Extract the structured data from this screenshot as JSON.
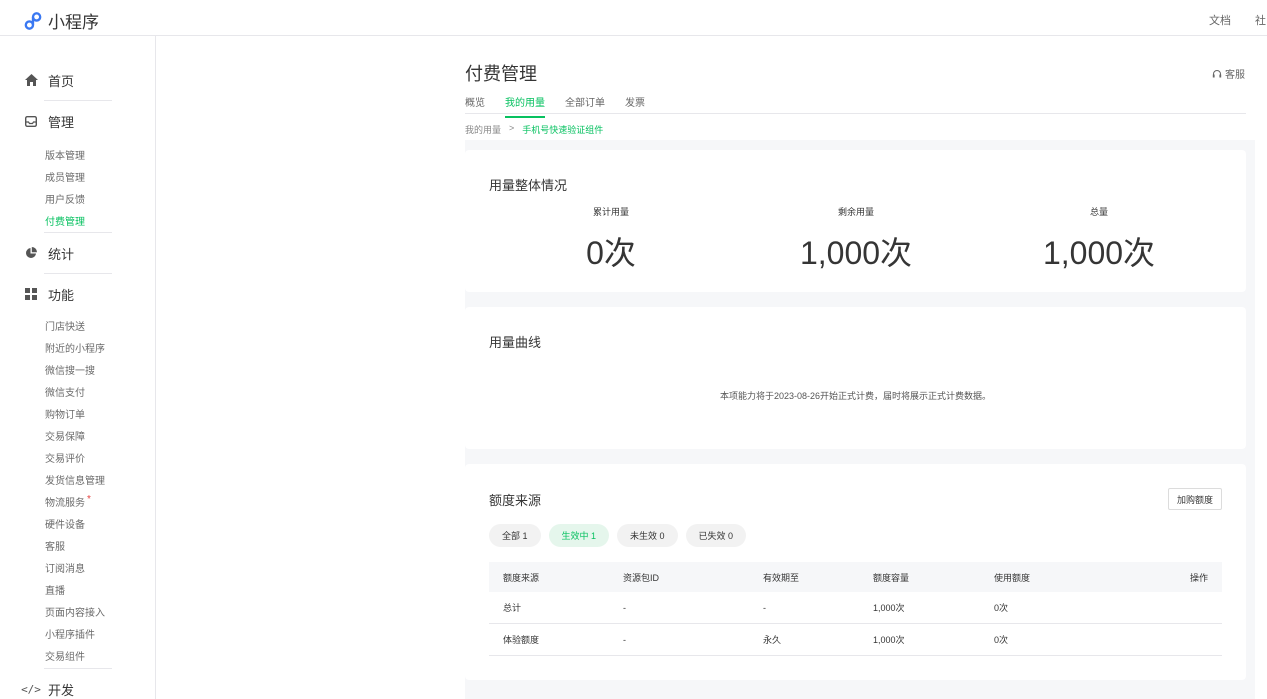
{
  "app": {
    "title": "小程序"
  },
  "top_links": [
    "文档",
    "社区"
  ],
  "sidebar": {
    "home": "首页",
    "manage": "管理",
    "manage_items": [
      "版本管理",
      "成员管理",
      "用户反馈",
      "付费管理"
    ],
    "stats": "统计",
    "features": "功能",
    "feature_items": [
      "门店快送",
      "附近的小程序",
      "微信搜一搜",
      "微信支付",
      "购物订单",
      "交易保障",
      "交易评价",
      "发货信息管理",
      "物流服务",
      "硬件设备",
      "客服",
      "订阅消息",
      "直播",
      "页面内容接入",
      "小程序插件",
      "交易组件"
    ],
    "dev": "开发",
    "red_mark": "*"
  },
  "page": {
    "title": "付费管理",
    "service": "客服",
    "tabs": [
      "概览",
      "我的用量",
      "全部订单",
      "发票"
    ],
    "breadcrumb": {
      "parent": "我的用量",
      "sep": ">",
      "current": "手机号快速验证组件"
    }
  },
  "usage": {
    "title": "用量整体情况",
    "stats": [
      {
        "label": "累计用量",
        "value": "0次"
      },
      {
        "label": "剩余用量",
        "value": "1,000次"
      },
      {
        "label": "总量",
        "value": "1,000次"
      }
    ]
  },
  "curve": {
    "title": "用量曲线",
    "notice": "本项能力将于2023-08-26开始正式计费，届时将展示正式计费数据。"
  },
  "quota": {
    "title": "额度来源",
    "buy_button": "加购额度",
    "filters": [
      "全部 1",
      "生效中 1",
      "未生效 0",
      "已失效 0"
    ],
    "columns": [
      "额度来源",
      "资源包ID",
      "有效期至",
      "额度容量",
      "使用额度",
      "操作"
    ],
    "rows": [
      [
        "总计",
        "-",
        "-",
        "1,000次",
        "0次",
        ""
      ],
      [
        "体验额度",
        "-",
        "永久",
        "1,000次",
        "0次",
        ""
      ]
    ]
  },
  "colors": {
    "accent": "#07c160",
    "page_bg": "#f6f7f9"
  }
}
